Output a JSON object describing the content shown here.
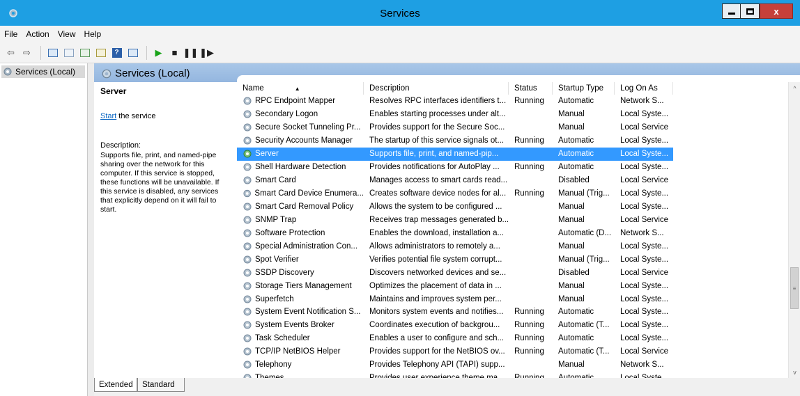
{
  "window": {
    "title": "Services"
  },
  "menu": [
    "File",
    "Action",
    "View",
    "Help"
  ],
  "tree": {
    "item": "Services (Local)"
  },
  "pane": {
    "title": "Services (Local)"
  },
  "details": {
    "service_name": "Server",
    "start_link": "Start",
    "start_suffix": " the service",
    "description_label": "Description:",
    "description_text": "Supports file, print, and named-pipe sharing over the network for this computer. If this service is stopped, these functions will be unavailable. If this service is disabled, any services that explicitly depend on it will fail to start."
  },
  "columns": [
    "Name",
    "Description",
    "Status",
    "Startup Type",
    "Log On As"
  ],
  "rows": [
    {
      "name": "RPC Endpoint Mapper",
      "description": "Resolves RPC interfaces identifiers t...",
      "status": "Running",
      "startup": "Automatic",
      "logon": "Network S..."
    },
    {
      "name": "Secondary Logon",
      "description": "Enables starting processes under alt...",
      "status": "",
      "startup": "Manual",
      "logon": "Local Syste..."
    },
    {
      "name": "Secure Socket Tunneling Pr...",
      "description": "Provides support for the Secure Soc...",
      "status": "",
      "startup": "Manual",
      "logon": "Local Service"
    },
    {
      "name": "Security Accounts Manager",
      "description": "The startup of this service signals ot...",
      "status": "Running",
      "startup": "Automatic",
      "logon": "Local Syste..."
    },
    {
      "name": "Server",
      "description": "Supports file, print, and named-pip...",
      "status": "",
      "startup": "Automatic",
      "logon": "Local Syste...",
      "selected": true
    },
    {
      "name": "Shell Hardware Detection",
      "description": "Provides notifications for AutoPlay ...",
      "status": "Running",
      "startup": "Automatic",
      "logon": "Local Syste..."
    },
    {
      "name": "Smart Card",
      "description": "Manages access to smart cards read...",
      "status": "",
      "startup": "Disabled",
      "logon": "Local Service"
    },
    {
      "name": "Smart Card Device Enumera...",
      "description": "Creates software device nodes for al...",
      "status": "Running",
      "startup": "Manual (Trig...",
      "logon": "Local Syste..."
    },
    {
      "name": "Smart Card Removal Policy",
      "description": "Allows the system to be configured ...",
      "status": "",
      "startup": "Manual",
      "logon": "Local Syste..."
    },
    {
      "name": "SNMP Trap",
      "description": "Receives trap messages generated b...",
      "status": "",
      "startup": "Manual",
      "logon": "Local Service"
    },
    {
      "name": "Software Protection",
      "description": "Enables the download, installation a...",
      "status": "",
      "startup": "Automatic (D...",
      "logon": "Network S..."
    },
    {
      "name": "Special Administration Con...",
      "description": "Allows administrators to remotely a...",
      "status": "",
      "startup": "Manual",
      "logon": "Local Syste..."
    },
    {
      "name": "Spot Verifier",
      "description": "Verifies potential file system corrupt...",
      "status": "",
      "startup": "Manual (Trig...",
      "logon": "Local Syste..."
    },
    {
      "name": "SSDP Discovery",
      "description": "Discovers networked devices and se...",
      "status": "",
      "startup": "Disabled",
      "logon": "Local Service"
    },
    {
      "name": "Storage Tiers Management",
      "description": "Optimizes the placement of data in ...",
      "status": "",
      "startup": "Manual",
      "logon": "Local Syste..."
    },
    {
      "name": "Superfetch",
      "description": "Maintains and improves system per...",
      "status": "",
      "startup": "Manual",
      "logon": "Local Syste..."
    },
    {
      "name": "System Event Notification S...",
      "description": "Monitors system events and notifies...",
      "status": "Running",
      "startup": "Automatic",
      "logon": "Local Syste..."
    },
    {
      "name": "System Events Broker",
      "description": "Coordinates execution of backgrou...",
      "status": "Running",
      "startup": "Automatic (T...",
      "logon": "Local Syste..."
    },
    {
      "name": "Task Scheduler",
      "description": "Enables a user to configure and sch...",
      "status": "Running",
      "startup": "Automatic",
      "logon": "Local Syste..."
    },
    {
      "name": "TCP/IP NetBIOS Helper",
      "description": "Provides support for the NetBIOS ov...",
      "status": "Running",
      "startup": "Automatic (T...",
      "logon": "Local Service"
    },
    {
      "name": "Telephony",
      "description": "Provides Telephony API (TAPI) supp...",
      "status": "",
      "startup": "Manual",
      "logon": "Network S..."
    },
    {
      "name": "Themes",
      "description": "Provides user experience theme ma...",
      "status": "Running",
      "startup": "Automatic",
      "logon": "Local Syste..."
    }
  ],
  "tabs": [
    "Extended",
    "Standard"
  ],
  "colors": {
    "titlebar": "#1e9fe3",
    "selection": "#3399ff",
    "close": "#c6403a",
    "pane_header": "#a9c7e8"
  }
}
